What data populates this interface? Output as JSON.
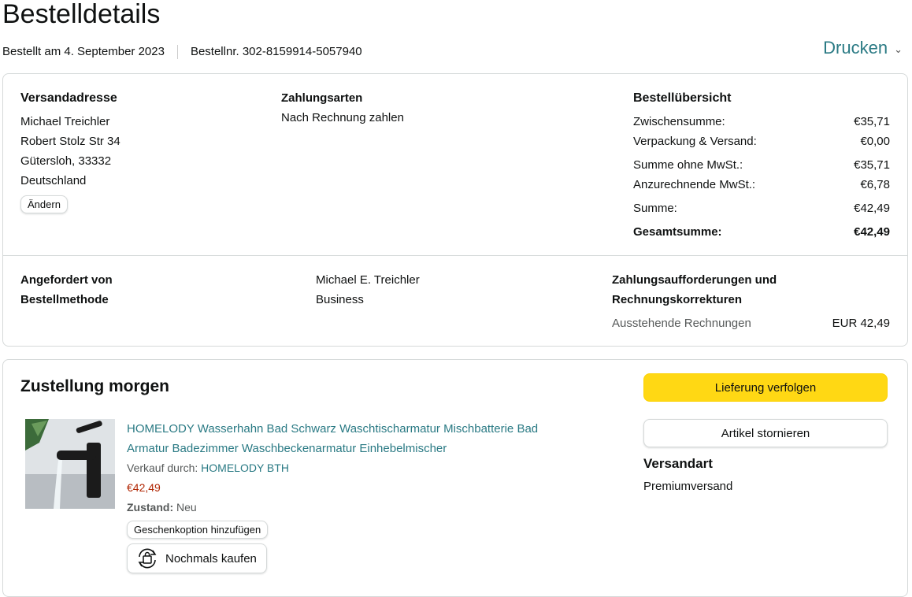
{
  "page": {
    "title": "Bestelldetails",
    "ordered_on": "Bestellt am 4. September 2023",
    "order_number": "Bestellnr. 302-8159914-5057940",
    "print_label": "Drucken"
  },
  "shipping": {
    "heading": "Versandadresse",
    "lines": [
      "Michael Treichler",
      "Robert Stolz Str 34",
      "Gütersloh, 33332",
      "Deutschland"
    ],
    "change_label": "Ändern"
  },
  "payment": {
    "heading": "Zahlungsarten",
    "method": "Nach Rechnung zahlen"
  },
  "summary": {
    "heading": "Bestellübersicht",
    "rows": [
      {
        "label": "Zwischensumme:",
        "value": "€35,71"
      },
      {
        "label": "Verpackung & Versand:",
        "value": "€0,00"
      },
      {
        "label": "Summe ohne MwSt.:",
        "value": "€35,71"
      },
      {
        "label": "Anzurechnende MwSt.:",
        "value": "€6,78"
      },
      {
        "label": "Summe:",
        "value": "€42,49"
      },
      {
        "label": "Gesamtsumme:",
        "value": "€42,49"
      }
    ]
  },
  "request": {
    "requested_by_label": "Angefordert von",
    "order_method_label": "Bestellmethode",
    "requested_by_value": "Michael E. Treichler",
    "order_method_value": "Business",
    "payment_requests_heading_1": "Zahlungsaufforderungen und",
    "payment_requests_heading_2": "Rechnungskorrekturen",
    "outstanding_label": "Ausstehende Rechnungen",
    "outstanding_value": "EUR 42,49"
  },
  "delivery": {
    "heading": "Zustellung morgen",
    "product_title_1": "HOMELODY Wasserhahn Bad Schwarz Waschtischarmatur Mischbatterie Bad",
    "product_title_2": "Armatur Badezimmer Waschbeckenarmatur Einhebelmischer",
    "sold_by_label": "Verkauf durch:",
    "seller": "HOMELODY BTH",
    "price": "€42,49",
    "condition_label": "Zustand:",
    "condition_value": "Neu",
    "gift_option_label": "Geschenkoption hinzufügen",
    "buy_again_label": "Nochmals kaufen",
    "track_label": "Lieferung verfolgen",
    "cancel_label": "Artikel stornieren",
    "shipping_type_heading": "Versandart",
    "shipping_type_value": "Premiumversand"
  },
  "colors": {
    "link": "#2a7a84",
    "price": "#b12704",
    "primary_button": "#ffd814"
  }
}
